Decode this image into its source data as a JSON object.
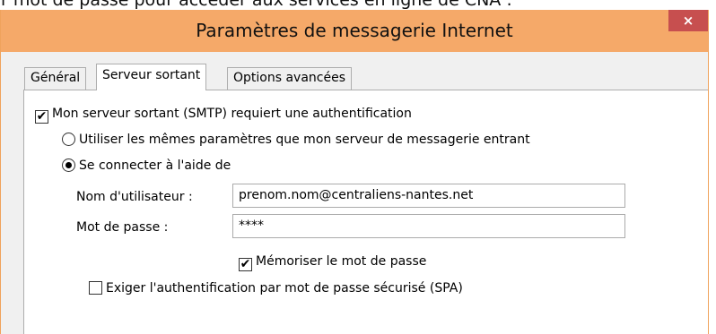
{
  "page_text": "r mot de passe pour accéder aux services en ligne de CNA :",
  "window": {
    "title": "Paramètres de messagerie Internet",
    "close_glyph": "×"
  },
  "tabs": [
    {
      "label": "Général",
      "active": false
    },
    {
      "label": "Serveur sortant",
      "active": true
    },
    {
      "label": "Options avancées",
      "active": false
    }
  ],
  "smtp_auth": {
    "label": "Mon serveur sortant (SMTP) requiert une authentification",
    "checked": true
  },
  "radio_same": {
    "label": "Utiliser les mêmes paramètres que mon serveur de messagerie entrant",
    "selected": false
  },
  "radio_connect": {
    "label": "Se connecter à l'aide de",
    "selected": true
  },
  "username": {
    "label": "Nom d'utilisateur :",
    "value": "prenom.nom@centraliens-nantes.net"
  },
  "password": {
    "label": "Mot de passe :",
    "value": "****"
  },
  "remember": {
    "label": "Mémoriser le mot de passe",
    "checked": true
  },
  "spa": {
    "label": "Exiger l'authentification par mot de passe sécurisé (SPA)",
    "checked": false
  },
  "check_glyph": "✔"
}
